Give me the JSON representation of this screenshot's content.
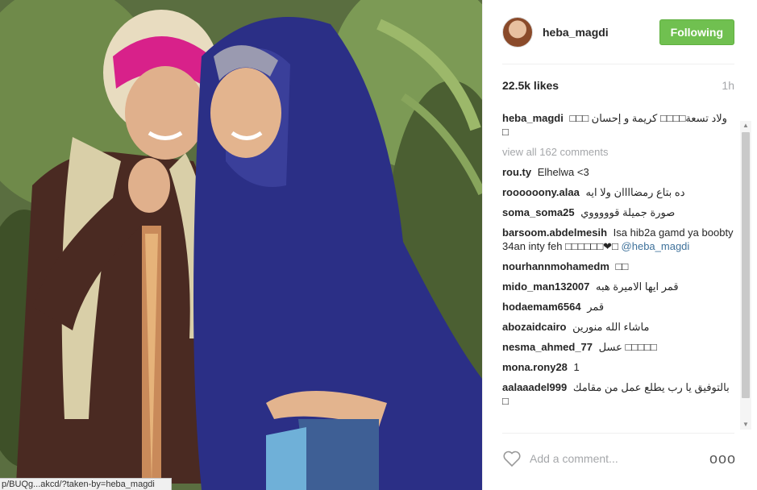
{
  "post": {
    "username": "heba_magdi",
    "follow_label": "Following",
    "likes": "22.5k likes",
    "time": "1h",
    "caption_user": "heba_magdi",
    "caption_text": "ولاد تسعة□□□□ كريمة و إحسان □□□ □",
    "view_all": "view all 162 comments",
    "add_comment_placeholder": "Add a comment...",
    "more_label": "ooo"
  },
  "comments": [
    {
      "user": "rou.ty",
      "text": "Elhelwa <3"
    },
    {
      "user": "roooooony.alaa",
      "text": "ده بتاع رمضاااان ولا ايه"
    },
    {
      "user": "soma_soma25",
      "text": "صورة جميلة قوووووي"
    },
    {
      "user": "barsoom.abdelmesih",
      "text": "Isa hib2a gamd ya boobty 34an inty feh □□□□□□❤□",
      "mention": "@heba_magdi"
    },
    {
      "user": "nourhannmohamedm",
      "text": "□□"
    },
    {
      "user": "mido_man132007",
      "text": "قمر ايها الاميرة هبه"
    },
    {
      "user": "hodaemam6564",
      "text": "قمر"
    },
    {
      "user": "abozaidcairo",
      "text": "ماشاء الله منورين"
    },
    {
      "user": "nesma_ahmed_77",
      "text": "عسل □□□□□"
    },
    {
      "user": "mona.rony28",
      "text": "1"
    },
    {
      "user": "aalaaadel999",
      "text": "بالتوفيق يا رب يطلع عمل من مقامك □"
    }
  ],
  "status_bar": {
    "url": "p/BUQg...akcd/?taken-by=heba_magdi"
  },
  "icons": {
    "heart": "heart-outline-icon",
    "more": "more-options-icon"
  },
  "colors": {
    "follow_button": "#70c050",
    "mention": "#3f729b",
    "muted": "#a5a7aa"
  }
}
